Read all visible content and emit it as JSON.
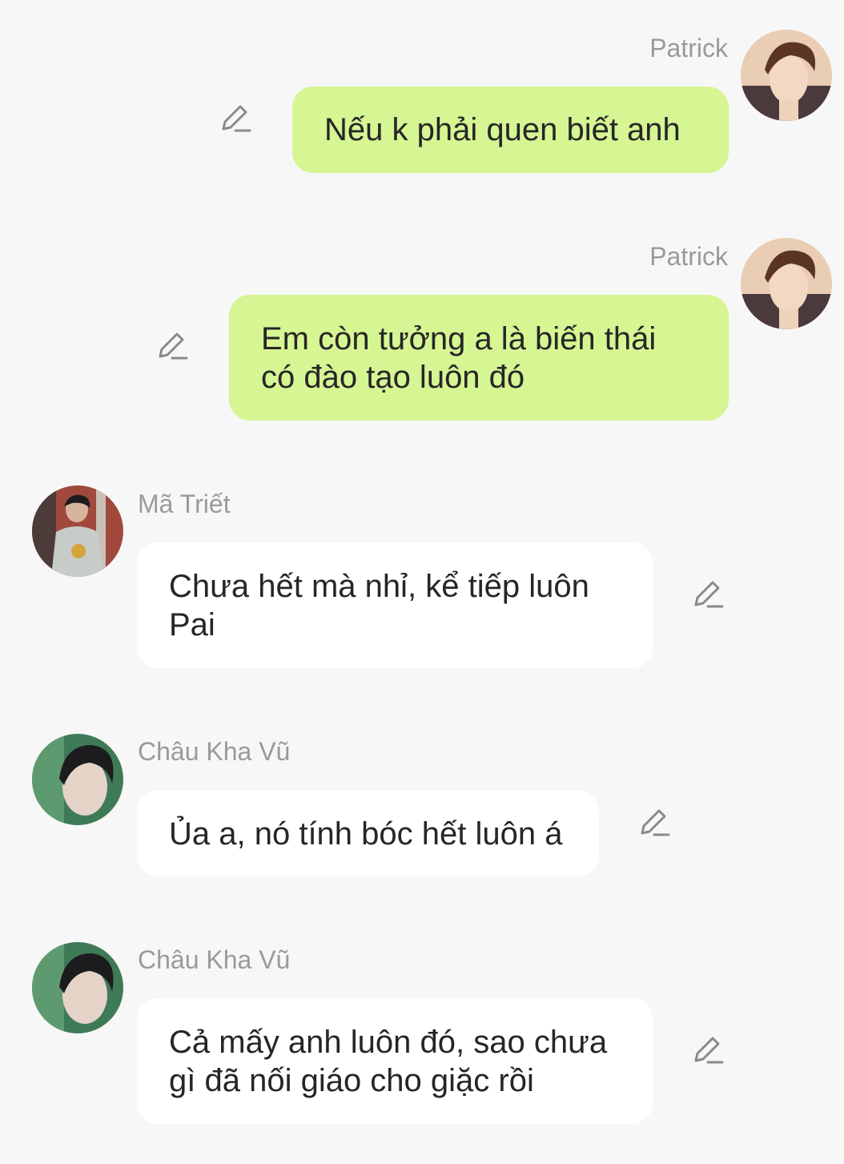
{
  "colors": {
    "background": "#f7f7f7",
    "sent_bubble": "#d6f593",
    "received_bubble": "#ffffff",
    "sender_name": "#9a9a9a",
    "message_text": "#262626"
  },
  "messages": [
    {
      "sender": "Patrick",
      "side": "right",
      "text": "Nếu k phải quen biết anh",
      "avatar_icon": "avatar-icon",
      "action_icon": "edit-icon"
    },
    {
      "sender": "Patrick",
      "side": "right",
      "text": "Em còn tưởng a là biến thái\ncó đào tạo luôn đó",
      "avatar_icon": "avatar-icon",
      "action_icon": "edit-icon"
    },
    {
      "sender": "Mã Triết",
      "side": "left",
      "text": "Chưa hết mà nhỉ, kể tiếp luôn\nPai",
      "avatar_icon": "avatar-icon",
      "action_icon": "edit-icon"
    },
    {
      "sender": "Châu Kha Vũ",
      "side": "left",
      "text": "Ủa a, nó tính bóc hết luôn á",
      "avatar_icon": "avatar-icon",
      "action_icon": "edit-icon"
    },
    {
      "sender": "Châu Kha Vũ",
      "side": "left",
      "text": "Cả mấy anh luôn đó, sao chưa\ngì đã nối giáo cho giặc rồi",
      "avatar_icon": "avatar-icon",
      "action_icon": "edit-icon"
    }
  ]
}
